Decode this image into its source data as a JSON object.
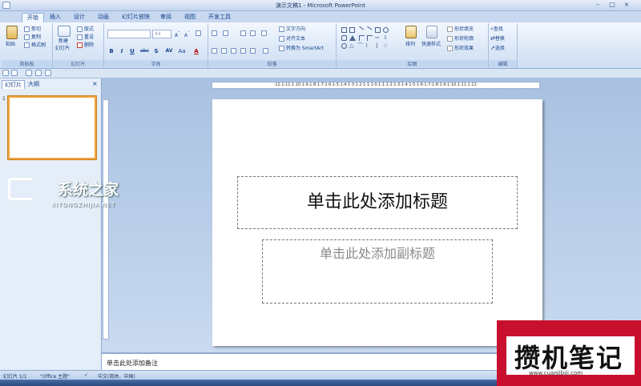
{
  "window": {
    "title": "演示文稿1 - Microsoft PowerPoint",
    "controls": [
      "–",
      "□",
      "×"
    ]
  },
  "ribbon_tabs": [
    "开始",
    "插入",
    "设计",
    "动画",
    "幻灯片放映",
    "审阅",
    "视图",
    "开发工具"
  ],
  "active_tab": "开始",
  "clipboard": {
    "paste": "粘贴",
    "cut": "剪切",
    "copy": "复制",
    "format_painter": "格式刷",
    "label": "剪贴板"
  },
  "slides_group": {
    "new_slide_line1": "新建",
    "new_slide_line2": "幻灯片",
    "layout": "版式",
    "reset": "重设",
    "delete": "删除",
    "label": "幻灯片"
  },
  "font_group": {
    "font_name": "",
    "font_size": "44",
    "bold": "B",
    "italic": "I",
    "underline": "U",
    "strike": "abc",
    "shadow": "S",
    "spacing": "AV",
    "case": "Aa",
    "color": "A",
    "label": "字体"
  },
  "paragraph_group": {
    "text_direction": "文字方向",
    "align_text": "对齐文本",
    "smartart": "转换为 SmartArt",
    "label": "段落"
  },
  "drawing_group": {
    "arrange": "排列",
    "quick_styles": "快速样式",
    "shape_fill": "形状填充",
    "shape_outline": "形状轮廓",
    "shape_effects": "形状效果",
    "label": "绘图"
  },
  "editing_group": {
    "find": "查找",
    "replace": "替换",
    "select": "选择",
    "label": "编辑"
  },
  "panel": {
    "tab_slides": "幻灯片",
    "tab_outline": "大纲",
    "close": "×",
    "slide_number": "1"
  },
  "ruler": {
    "h": "·12·1·11·1·10·1·9·1·8·1·7·1·6·1·5·1·4·1·3·1·2·1·1·1·0·1·1·1·2·1·3·1·4·1·5·1·6·1·7·1·8·1·9·1·10·1·11·1·12·"
  },
  "slide": {
    "title_placeholder": "单击此处添加标题",
    "subtitle_placeholder": "单击此处添加副标题"
  },
  "notes": {
    "placeholder": "单击此处添加备注"
  },
  "statusbar": {
    "slide": "幻灯片 1/1",
    "theme": "\"Office 主题\"",
    "language": "中文(简体，中国)"
  },
  "watermarks": {
    "left_cn": "系统之家",
    "left_en": "XITONGZHIJIA.NET",
    "right_cn": "攒机笔记",
    "right_url": "www.cuanjibiji.com"
  }
}
